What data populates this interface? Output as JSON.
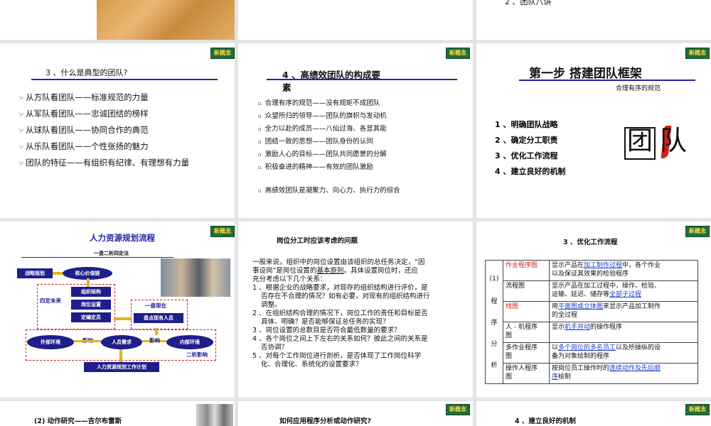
{
  "logo_text": "新概念",
  "s1": {},
  "s3": {
    "list_item": "2 、团队八讲"
  },
  "s4": {
    "title": "3 、什么是典型的团队?",
    "items": [
      "从方队看团队——标准规范的力量",
      "从军队看团队——忠诚团结的榜样",
      "从球队看团队——协同合作的典范",
      "从乐队看团队——个性张扬的魅力",
      "团队的特征——有组织有纪律、有理想有力量"
    ]
  },
  "s5": {
    "title_line1": "4 、高绩效团队的构成要",
    "title_line2": "素",
    "items": [
      "合理有序的规范——没有规矩不成团队",
      "众望所归的领导——团队的旗帜与发动机",
      "全力以赴的成员——八仙过海、各显其能",
      "团结一致的思想——团队身份的认同",
      "激励人心的目标——团队共同愿景的分解",
      "积极奋进的精神——有效的团队激励"
    ],
    "summary": "高绩效团队是凝聚力、向心力、执行力的综合"
  },
  "s6": {
    "title": "第一步 搭建团队框架",
    "subtitle": "合理有序的规范",
    "items": [
      "1 、明确团队战略",
      "2 、确定分工职责",
      "3 、优化工作流程",
      "4 、建立良好的机制"
    ],
    "char1": "团",
    "char2": "队"
  },
  "s7": {
    "title": "人力资源规划流程",
    "subtitle": "一盘二析四定法",
    "labels": {
      "strategy": "战略规划",
      "core_values": "核心价值链",
      "org": "组织结构",
      "positions": "岗位设置",
      "staffing": "定编定员",
      "four_define": "四定未来",
      "one_count": "一盘现在",
      "count_staff": "盘点现有人员",
      "external": "外部环境",
      "internal": "内部环境",
      "hr_demand": "人员需求",
      "influence_left": "影响",
      "influence_right": "影响",
      "two_analysis": "二析影响",
      "plan": "人力资源规划工作计划"
    }
  },
  "s8": {
    "title": "岗位分工时应该考虑的问题",
    "intro": [
      "一般来说，组织中的岗位设置由该组织的总任务决定，“因",
      "事设岗”是岗位设置的",
      "基本原则",
      "。具体设置岗位时，还应",
      "充分考虑以下几个关系："
    ],
    "items": [
      [
        "1 、根据企业的战略要求，对现存的组织结构进行评价，是",
        "否存在不合理的情况？如有必要，对现有的组织结构进行",
        "调整。"
      ],
      [
        "2 、在组织结构合理的情况下，岗位工作的责任和目标是否",
        "具体、明确？是否能够保证总任务的实现？"
      ],
      [
        "3 、岗位设置的总数目是否符合最低数量的要求？"
      ],
      [
        "4 、各个岗位之间上下左右的关系如何？彼此之间的关系是",
        "否协调？"
      ],
      [
        "5 、对每个工作岗位进行剖析，是否体现了工作岗位科学",
        "化、合理化、系统化的设置要求？"
      ]
    ]
  },
  "s9": {
    "title": "3 、优化工作流程",
    "left_col": [
      "(1)",
      "程",
      "序",
      "分",
      "析"
    ],
    "rows": [
      {
        "name": "作业程序图",
        "desc1_pre": "显示产品在",
        "desc1_link": "加工制作过程",
        "desc1_post": "中，各个作业",
        "desc2": "以及保证其效果的检验程序"
      },
      {
        "name": "流程图",
        "desc1_pre": "显示产品在加工过程中，操作、检验、",
        "desc1_link": "",
        "desc1_post": "",
        "desc2": "运输、延迟、储存等",
        "desc2_link": "全部子过程"
      },
      {
        "name": "线图",
        "desc1_pre": "用",
        "desc1_link": "平面图或立体图",
        "desc1_post": "来显示产品加工制作",
        "desc2": "的全过程"
      },
      {
        "name": "人 - 机程序",
        "name2": "图",
        "desc1_pre": "显示",
        "desc1_link": "机手并动",
        "desc1_post": "的操作程序",
        "desc2": ""
      },
      {
        "name": "多作业程序",
        "name2": "图",
        "desc1_pre": "以",
        "desc1_link": "多个岗位的多名员工",
        "desc1_post": "以及所操纵的设",
        "desc2": "备为对象绘制的程序"
      },
      {
        "name": "操作人程序",
        "name2": "图",
        "desc1_pre": "按岗位员工操作时的",
        "desc1_link": "连续动作及先后顺",
        "desc1_post": "",
        "desc2_link": "序",
        "desc2": "绘制"
      }
    ]
  },
  "s10": {
    "title": "(2) 动作研究——吉尔布雷斯"
  },
  "s11": {
    "title": "如何应用程序分析或动作研究?"
  },
  "s12": {
    "title": "4 、建立良好的机制"
  },
  "colors": {
    "accent_blue": "#2323a8",
    "flow_blue": "#1f1f8a",
    "flow_arrow": "#e3b420",
    "red": "#d42020"
  }
}
